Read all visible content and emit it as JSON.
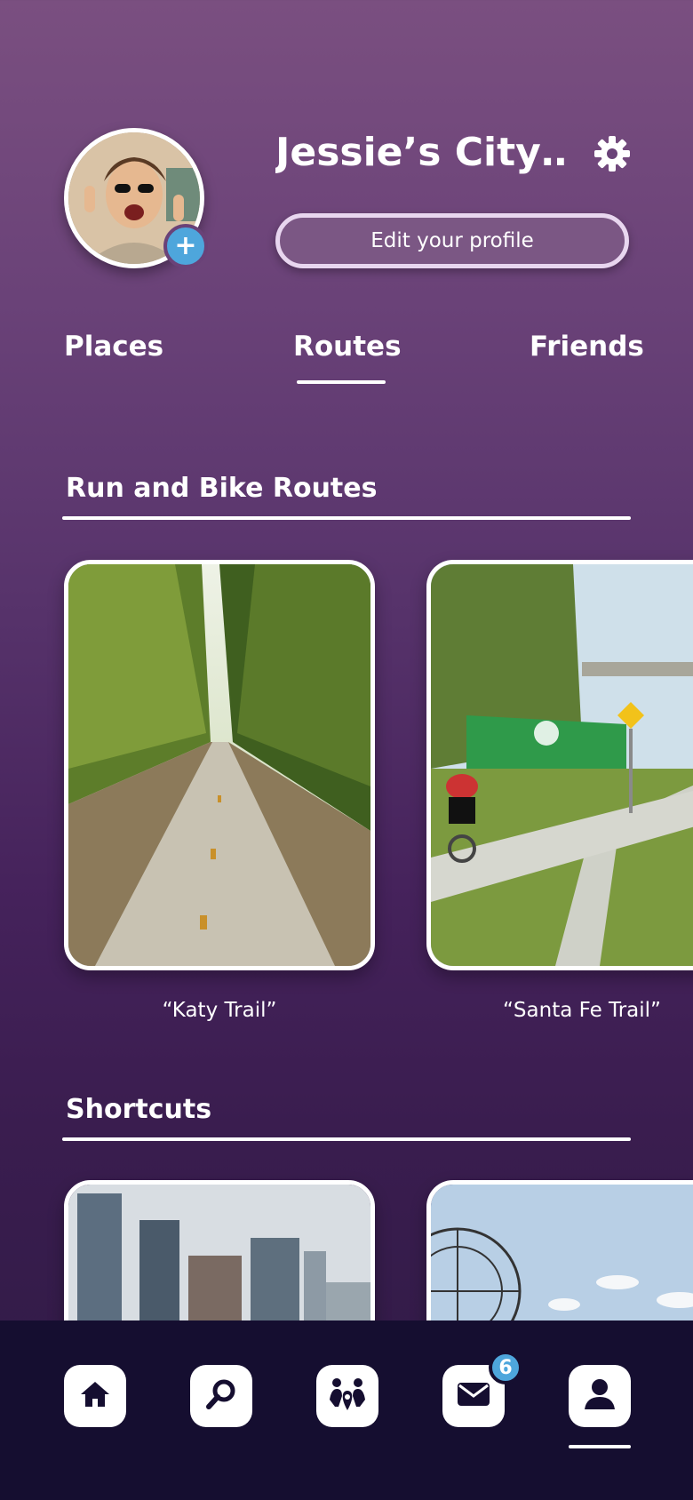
{
  "profile": {
    "name": "Jessie’s City…",
    "edit_label": "Edit your profile",
    "add_icon": "+"
  },
  "tabs": [
    {
      "label": "Places",
      "active": false
    },
    {
      "label": "Routes",
      "active": true
    },
    {
      "label": "Friends",
      "active": false
    }
  ],
  "routes_section": {
    "title": "Run and Bike Routes",
    "cards": [
      {
        "caption": "“Katy Trail”"
      },
      {
        "caption": "“Santa Fe Trail”"
      }
    ]
  },
  "shortcuts_section": {
    "title": "Shortcuts"
  },
  "bottom_nav": {
    "items": [
      "home-icon",
      "search-icon",
      "friends-location-icon",
      "mail-icon",
      "profile-icon"
    ],
    "mail_badge": "6",
    "active": "profile-icon"
  },
  "colors": {
    "accent": "#4ea6dc",
    "nav_bg": "#150e30",
    "bg_top": "#7a4f80",
    "bg_bottom": "#2f1a45"
  }
}
